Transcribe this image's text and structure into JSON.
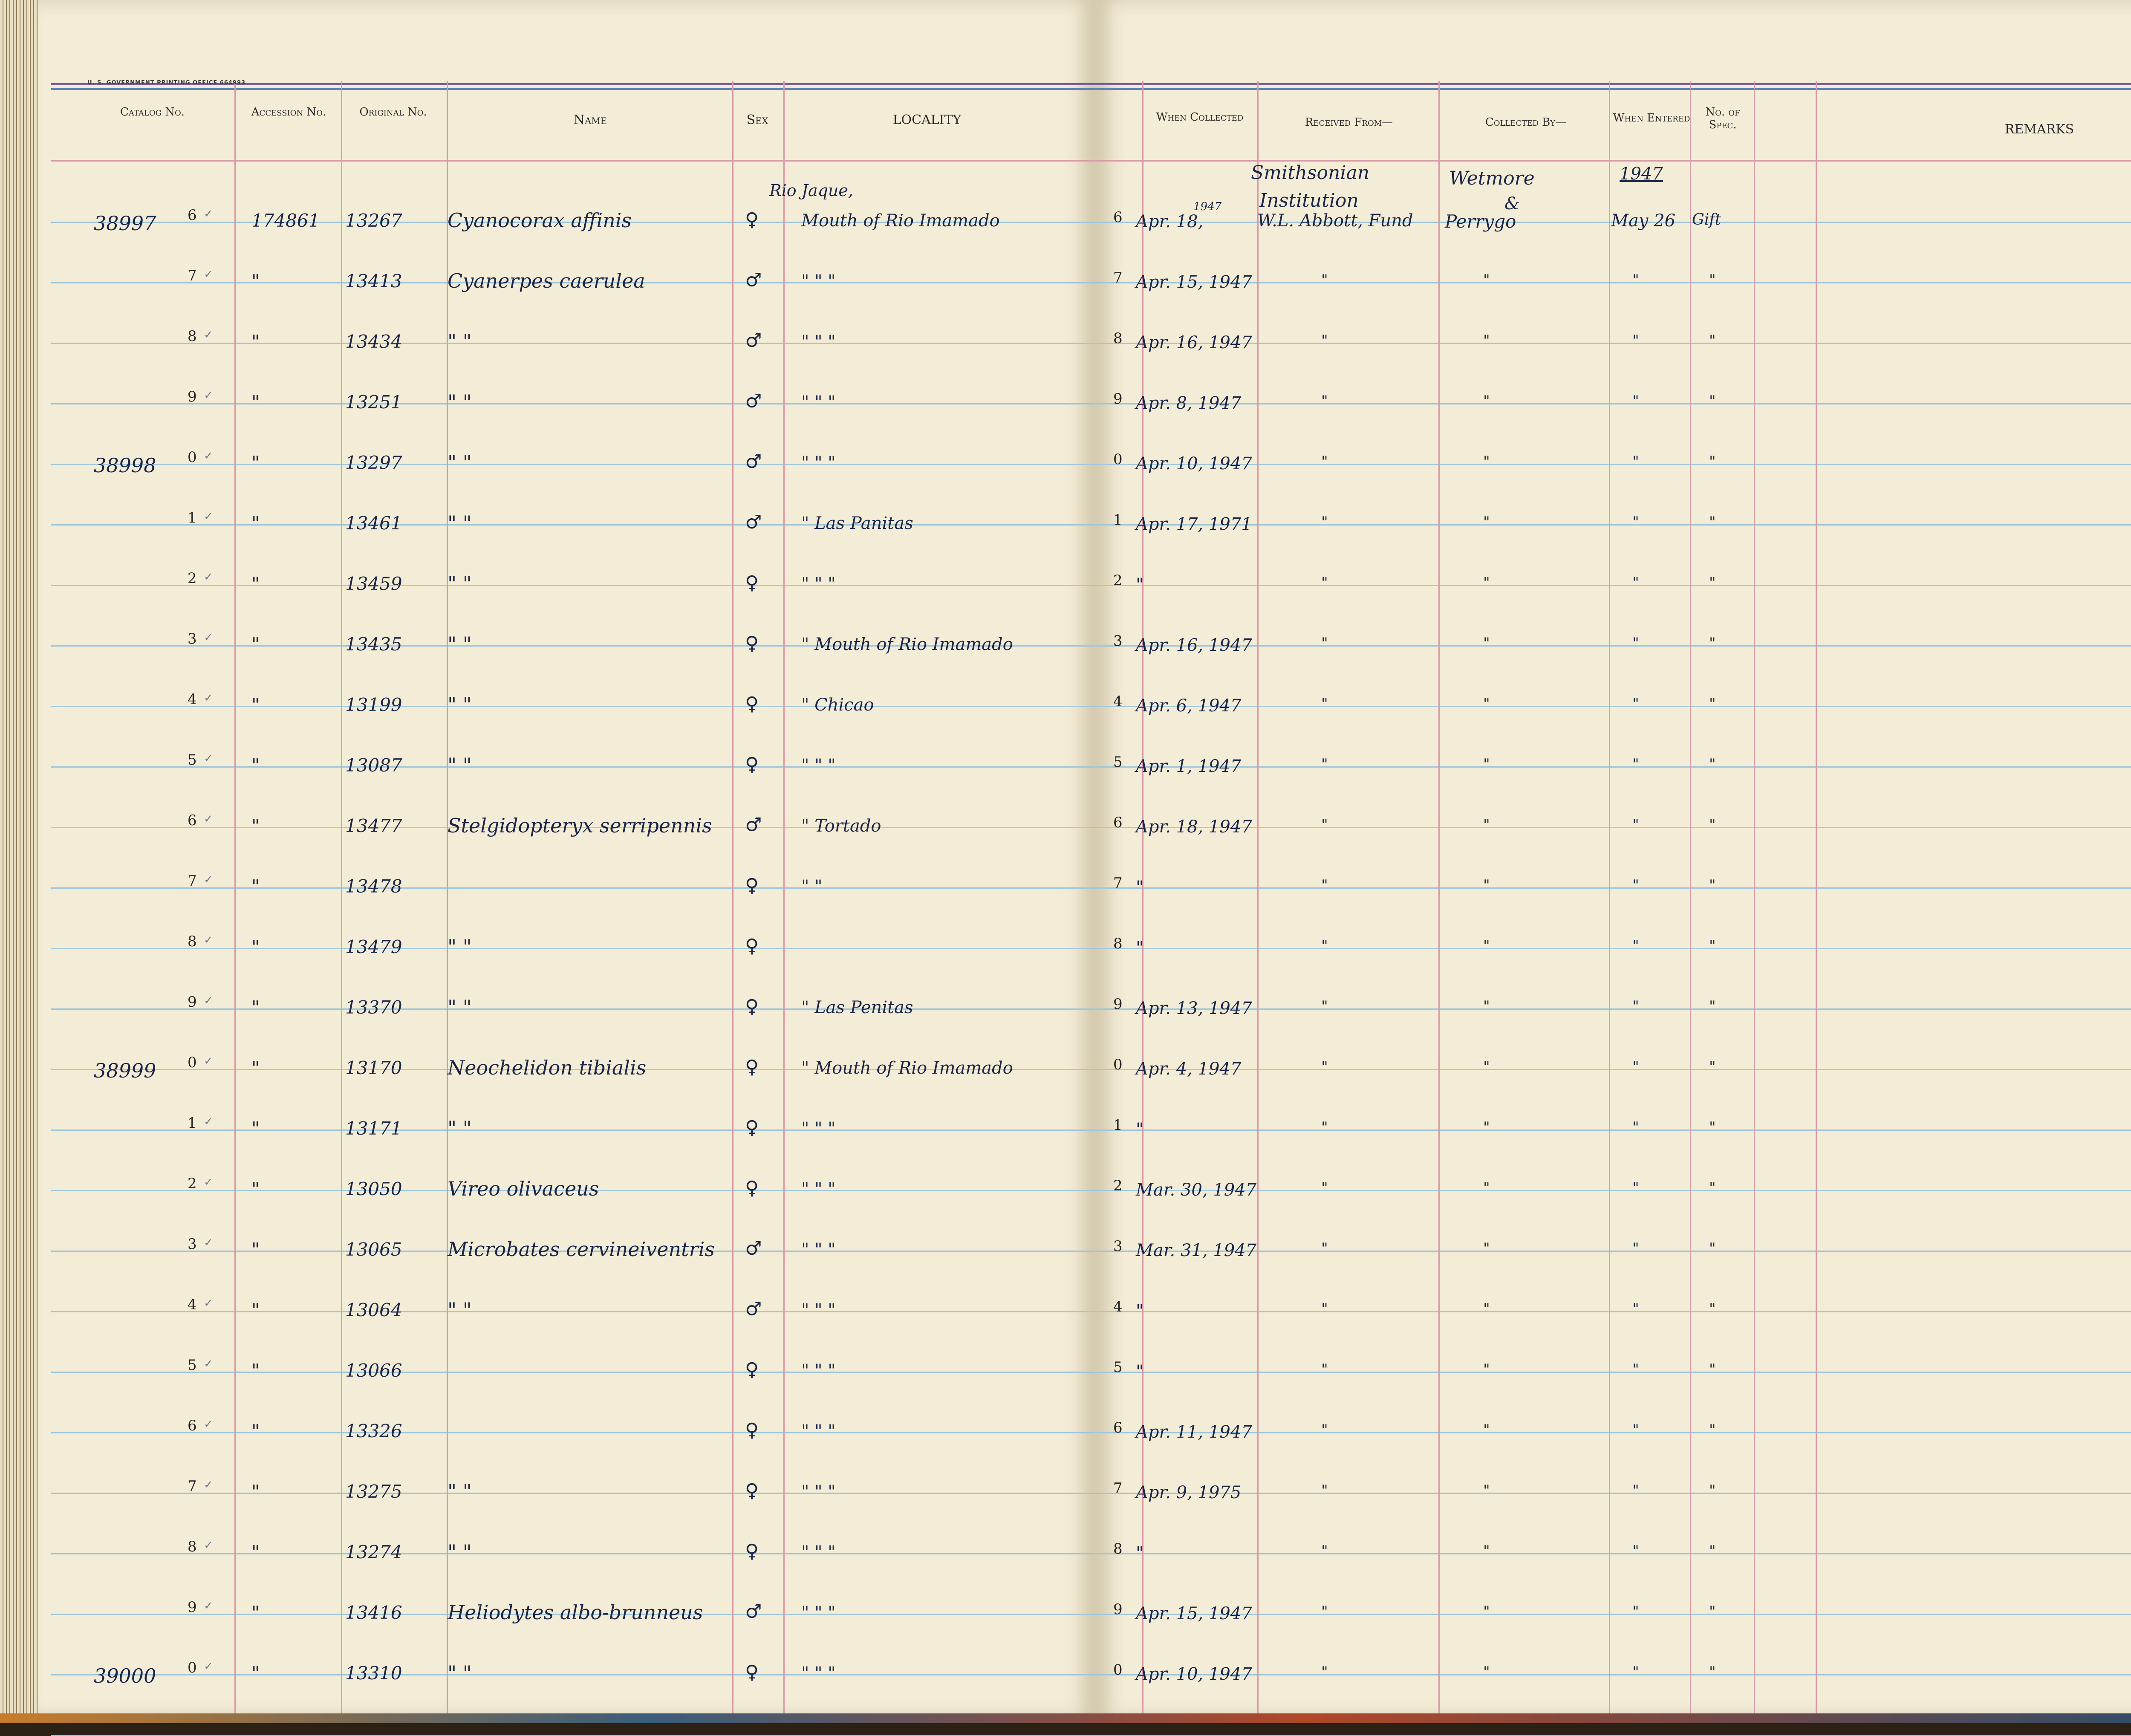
{
  "ledger": {
    "printer_imprint": "U. S. GOVERNMENT PRINTING OFFICE     664993",
    "headers": {
      "catalog": "Catalog No.",
      "accession": "Accession No.",
      "original": "Original No.",
      "name": "Name",
      "sex": "Sex",
      "locality": "LOCALITY",
      "when_collected": "When Collected",
      "received_from": "Received From—",
      "collected_by": "Collected By—",
      "when_entered": "When Entered",
      "no_of_spec": "No. of Spec.",
      "remarks": "REMARKS"
    },
    "top_notes": {
      "locality_head": "Rio Jaque,",
      "year_small": "1947",
      "received_1": "Smithsonian",
      "received_2": "Institution",
      "collected_1": "Wetmore",
      "collected_2": "&",
      "entered_year": "1947"
    },
    "rows": [
      {
        "cat": "38997",
        "digit": "6",
        "acc": "174861",
        "orig": "13267",
        "name": "Cyanocorax affinis",
        "sex": "♀",
        "loc": "Mouth of Rio Imamado",
        "ldig": "6",
        "when": "Apr. 18,",
        "recv": "W.L. Abbott, Fund",
        "coll": "Perrygo",
        "ent": "May 26",
        "spec": "Gift"
      },
      {
        "cat": "",
        "digit": "7",
        "acc": "\"",
        "orig": "13413",
        "name": "Cyanerpes caerulea",
        "sex": "♂",
        "loc": "\"  \"  \"",
        "ldig": "7",
        "when": "Apr. 15, 1947",
        "recv": "\"",
        "coll": "\"",
        "ent": "\"",
        "spec": "\""
      },
      {
        "cat": "",
        "digit": "8",
        "acc": "\"",
        "orig": "13434",
        "name": "\"    \"",
        "sex": "♂",
        "loc": "\"  \"  \"",
        "ldig": "8",
        "when": "Apr. 16, 1947",
        "recv": "\"",
        "coll": "\"",
        "ent": "\"",
        "spec": "\""
      },
      {
        "cat": "",
        "digit": "9",
        "acc": "\"",
        "orig": "13251",
        "name": "\"    \"",
        "sex": "♂",
        "loc": "\"  \"  \"",
        "ldig": "9",
        "when": "Apr. 8, 1947",
        "recv": "\"",
        "coll": "\"",
        "ent": "\"",
        "spec": "\""
      },
      {
        "cat": "38998",
        "digit": "0",
        "acc": "\"",
        "orig": "13297",
        "name": "\"    \"",
        "sex": "♂",
        "loc": "\"  \"  \"",
        "ldig": "0",
        "when": "Apr. 10, 1947",
        "recv": "\"",
        "coll": "\"",
        "ent": "\"",
        "spec": "\""
      },
      {
        "cat": "",
        "digit": "1",
        "acc": "\"",
        "orig": "13461",
        "name": "\"    \"",
        "sex": "♂",
        "loc": "\"  Las Panitas",
        "ldig": "1",
        "when": "Apr. 17, 1971",
        "recv": "\"",
        "coll": "\"",
        "ent": "\"",
        "spec": "\""
      },
      {
        "cat": "",
        "digit": "2",
        "acc": "\"",
        "orig": "13459",
        "name": "\"    \"",
        "sex": "♀",
        "loc": "\"  \"  \"",
        "ldig": "2",
        "when": "\"",
        "recv": "\"",
        "coll": "\"",
        "ent": "\"",
        "spec": "\""
      },
      {
        "cat": "",
        "digit": "3",
        "acc": "\"",
        "orig": "13435",
        "name": "\"    \"",
        "sex": "♀",
        "loc": "\" Mouth of Rio Imamado",
        "ldig": "3",
        "when": "Apr. 16, 1947",
        "recv": "\"",
        "coll": "\"",
        "ent": "\"",
        "spec": "\""
      },
      {
        "cat": "",
        "digit": "4",
        "acc": "\"",
        "orig": "13199",
        "name": "\"    \"",
        "sex": "♀",
        "loc": "\"  Chicao",
        "ldig": "4",
        "when": "Apr. 6, 1947",
        "recv": "\"",
        "coll": "\"",
        "ent": "\"",
        "spec": "\""
      },
      {
        "cat": "",
        "digit": "5",
        "acc": "\"",
        "orig": "13087",
        "name": "\"    \"",
        "sex": "♀",
        "loc": "\"  \"  \"",
        "ldig": "5",
        "when": "Apr. 1, 1947",
        "recv": "\"",
        "coll": "\"",
        "ent": "\"",
        "spec": "\""
      },
      {
        "cat": "",
        "digit": "6",
        "acc": "\"",
        "orig": "13477",
        "name": "Stelgidopteryx serripennis",
        "sex": "♂",
        "loc": "\"  Tortado",
        "ldig": "6",
        "when": "Apr. 18, 1947",
        "recv": "\"",
        "coll": "\"",
        "ent": "\"",
        "spec": "\""
      },
      {
        "cat": "",
        "digit": "7",
        "acc": "\"",
        "orig": "13478",
        "name": "",
        "sex": "♀",
        "loc": "\"  \"",
        "ldig": "7",
        "when": "\"",
        "recv": "\"",
        "coll": "\"",
        "ent": "\"",
        "spec": "\""
      },
      {
        "cat": "",
        "digit": "8",
        "acc": "\"",
        "orig": "13479",
        "name": "\"    \"",
        "sex": "♀",
        "loc": "",
        "ldig": "8",
        "when": "\"",
        "recv": "\"",
        "coll": "\"",
        "ent": "\"",
        "spec": "\""
      },
      {
        "cat": "",
        "digit": "9",
        "acc": "\"",
        "orig": "13370",
        "name": "\"    \"",
        "sex": "♀",
        "loc": "\"  Las Penitas",
        "ldig": "9",
        "when": "Apr. 13, 1947",
        "recv": "\"",
        "coll": "\"",
        "ent": "\"",
        "spec": "\""
      },
      {
        "cat": "38999",
        "digit": "0",
        "acc": "\"",
        "orig": "13170",
        "name": "Neochelidon tibialis",
        "sex": "♀",
        "loc": "\" Mouth of Rio Imamado",
        "ldig": "0",
        "when": "Apr. 4, 1947",
        "recv": "\"",
        "coll": "\"",
        "ent": "\"",
        "spec": "\""
      },
      {
        "cat": "",
        "digit": "1",
        "acc": "\"",
        "orig": "13171",
        "name": "\"    \"",
        "sex": "♀",
        "loc": "\"  \"  \"",
        "ldig": "1",
        "when": "\"",
        "recv": "\"",
        "coll": "\"",
        "ent": "\"",
        "spec": "\""
      },
      {
        "cat": "",
        "digit": "2",
        "acc": "\"",
        "orig": "13050",
        "name": "Vireo olivaceus",
        "sex": "♀",
        "loc": "\"  \"  \"",
        "ldig": "2",
        "when": "Mar. 30, 1947",
        "recv": "\"",
        "coll": "\"",
        "ent": "\"",
        "spec": "\""
      },
      {
        "cat": "",
        "digit": "3",
        "acc": "\"",
        "orig": "13065",
        "name": "Microbates cervineiventris",
        "sex": "♂",
        "loc": "\"  \"  \"",
        "ldig": "3",
        "when": "Mar. 31, 1947",
        "recv": "\"",
        "coll": "\"",
        "ent": "\"",
        "spec": "\""
      },
      {
        "cat": "",
        "digit": "4",
        "acc": "\"",
        "orig": "13064",
        "name": "\"    \"",
        "sex": "♂",
        "loc": "\"  \"  \"",
        "ldig": "4",
        "when": "\"",
        "recv": "\"",
        "coll": "\"",
        "ent": "\"",
        "spec": "\""
      },
      {
        "cat": "",
        "digit": "5",
        "acc": "\"",
        "orig": "13066",
        "name": "",
        "sex": "♀",
        "loc": "\"  \"  \"",
        "ldig": "5",
        "when": "\"",
        "recv": "\"",
        "coll": "\"",
        "ent": "\"",
        "spec": "\""
      },
      {
        "cat": "",
        "digit": "6",
        "acc": "\"",
        "orig": "13326",
        "name": "",
        "sex": "♀",
        "loc": "\"  \"  \"",
        "ldig": "6",
        "when": "Apr. 11, 1947",
        "recv": "\"",
        "coll": "\"",
        "ent": "\"",
        "spec": "\""
      },
      {
        "cat": "",
        "digit": "7",
        "acc": "\"",
        "orig": "13275",
        "name": "\"    \"",
        "sex": "♀",
        "loc": "\"  \"  \"",
        "ldig": "7",
        "when": "Apr. 9, 1975",
        "recv": "\"",
        "coll": "\"",
        "ent": "\"",
        "spec": "\""
      },
      {
        "cat": "",
        "digit": "8",
        "acc": "\"",
        "orig": "13274",
        "name": "\"    \"",
        "sex": "♀",
        "loc": "\"  \"  \"",
        "ldig": "8",
        "when": "\"",
        "recv": "\"",
        "coll": "\"",
        "ent": "\"",
        "spec": "\""
      },
      {
        "cat": "",
        "digit": "9",
        "acc": "\"",
        "orig": "13416",
        "name": "Heliodytes albo-brunneus",
        "sex": "♂",
        "loc": "\"  \"  \"",
        "ldig": "9",
        "when": "Apr. 15, 1947",
        "recv": "\"",
        "coll": "\"",
        "ent": "\"",
        "spec": "\""
      },
      {
        "cat": "39000",
        "digit": "0",
        "acc": "\"",
        "orig": "13310",
        "name": "\"    \"",
        "sex": "♀",
        "loc": "\"  \"  \"",
        "ldig": "0",
        "when": "Apr. 10, 1947",
        "recv": "\"",
        "coll": "\"",
        "ent": "\"",
        "spec": "\""
      }
    ]
  },
  "colors": {
    "paper": "#f3ecd6",
    "rule_blue": "#9fc6da",
    "rule_red": "#d89aa8",
    "ink": "#1b2548"
  }
}
